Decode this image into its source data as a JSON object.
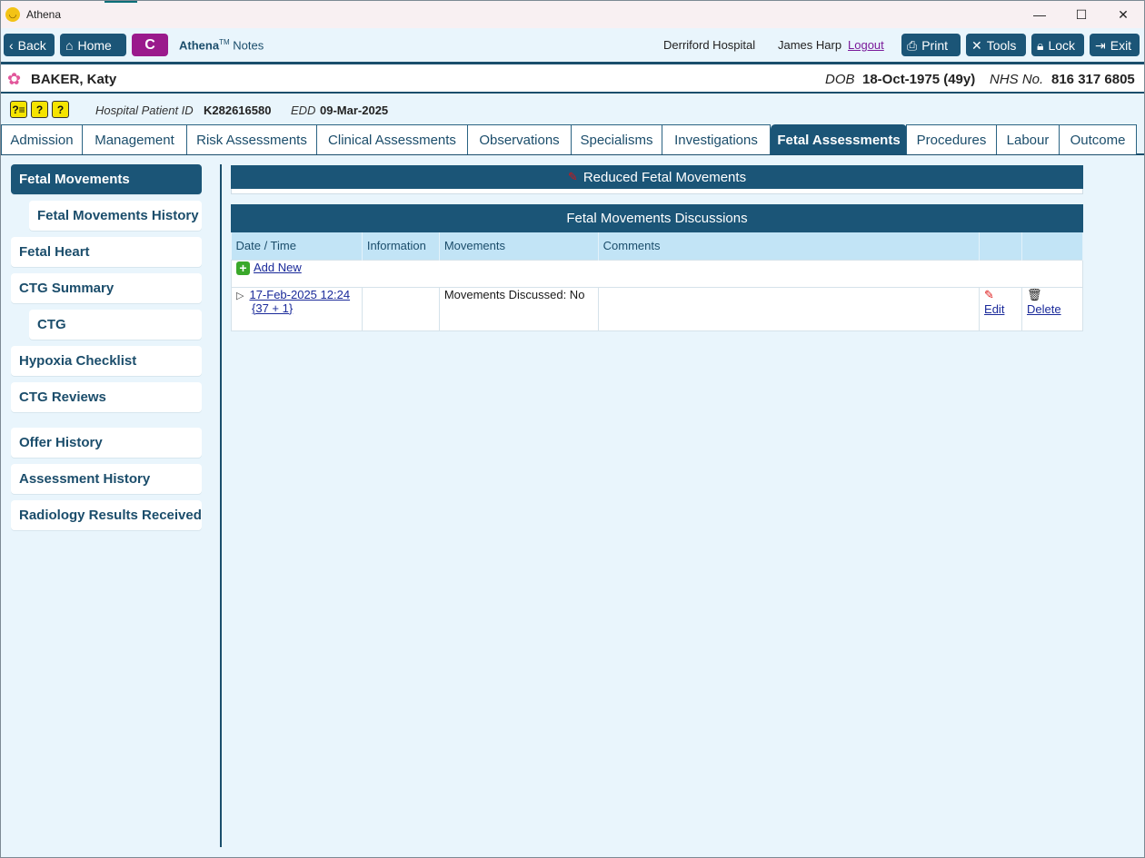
{
  "window": {
    "title": "Athena"
  },
  "toolbar": {
    "back": "Back",
    "home": "Home",
    "c_button": "C",
    "brand_name": "Athena",
    "brand_tm": "TM",
    "brand_suffix": "Notes",
    "hospital": "Derriford Hospital",
    "user": "James Harp",
    "logout": "Logout",
    "print": "Print",
    "tools": "Tools",
    "lock": "Lock",
    "exit": "Exit"
  },
  "patient": {
    "name": "BAKER, Katy",
    "dob_label": "DOB",
    "dob_value": "18-Oct-1975 (49y)",
    "nhs_label": "NHS No.",
    "nhs_value": "816 317 6805"
  },
  "info": {
    "hospital_id_label": "Hospital Patient ID",
    "hospital_id_value": "K282616580",
    "edd_label": "EDD",
    "edd_value": "09-Mar-2025"
  },
  "tabs": [
    "Admission",
    "Management",
    "Risk Assessments",
    "Clinical Assessments",
    "Observations",
    "Specialisms",
    "Investigations",
    "Fetal Assessments",
    "Procedures",
    "Labour",
    "Outcome"
  ],
  "active_tab": "Fetal Assessments",
  "sidebar": {
    "items": [
      {
        "label": "Fetal Movements"
      },
      {
        "label": "Fetal Movements History"
      },
      {
        "label": "Fetal Heart"
      },
      {
        "label": "CTG Summary"
      },
      {
        "label": "CTG"
      },
      {
        "label": "Hypoxia Checklist"
      },
      {
        "label": "CTG Reviews"
      },
      {
        "label": "Offer History"
      },
      {
        "label": "Assessment History"
      },
      {
        "label": "Radiology Results Received"
      }
    ]
  },
  "main": {
    "reduced_title": "Reduced Fetal Movements",
    "discussions_title": "Fetal Movements Discussions",
    "columns": [
      "Date / Time",
      "Information",
      "Movements",
      "Comments",
      "",
      ""
    ],
    "add_new": "Add New",
    "rows": [
      {
        "date": "17-Feb-2025 12:24",
        "gestation": "{37 + 1}",
        "information": "",
        "movements": "Movements Discussed: No",
        "comments": "",
        "edit": "Edit",
        "delete": "Delete"
      }
    ]
  }
}
